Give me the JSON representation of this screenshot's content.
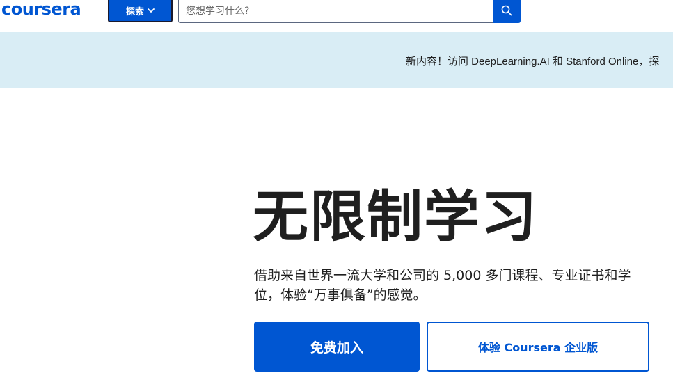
{
  "header": {
    "logo_text": "coursera",
    "explore_label": "探索",
    "search_placeholder": "您想学习什么?"
  },
  "banner": {
    "text": "新内容！访问 DeepLearning.AI 和 Stanford Online，探"
  },
  "hero": {
    "title": "无限制学习",
    "subtitle": "借助来自世界一流大学和公司的 5,000 多门课程、专业证书和学位，体验“万事俱备”的感觉。",
    "primary_cta": "免费加入",
    "secondary_cta": "体验 Coursera 企业版"
  },
  "colors": {
    "brand_blue": "#0056d2",
    "banner_bg": "#d9edf5",
    "text_dark": "#1f1f1f"
  },
  "icons": {
    "explore_chevron": "chevron-down-icon",
    "search": "search-icon"
  }
}
